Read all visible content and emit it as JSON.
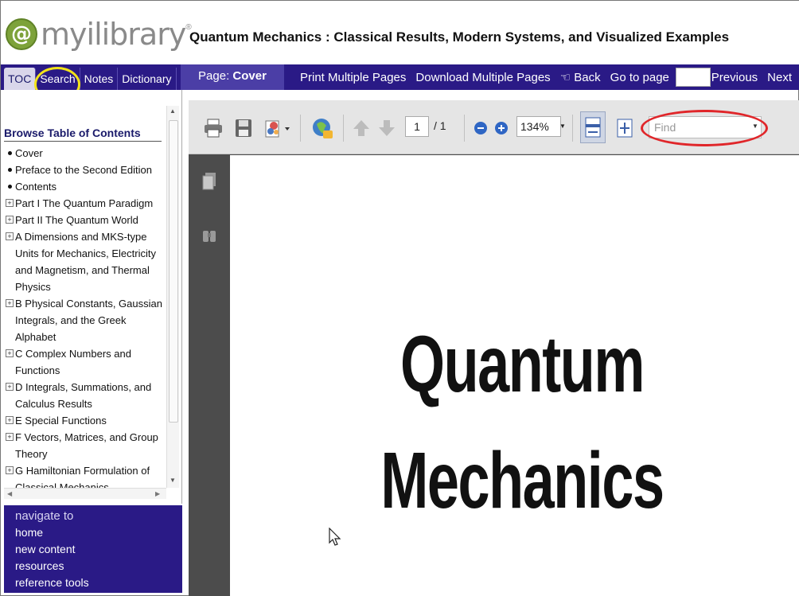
{
  "header": {
    "logo_text": "myilibrary",
    "logo_badge": "@",
    "logo_reg": "®",
    "book_title": "Quantum Mechanics : Classical Results, Modern Systems, and Visualized Examples"
  },
  "navbar": {
    "tabs": [
      {
        "label": "TOC"
      },
      {
        "label": "Search"
      },
      {
        "label": "Notes"
      },
      {
        "label": "Dictionary"
      }
    ],
    "page_label_prefix": "Page:",
    "page_label_value": "Cover",
    "links": {
      "print": "Print Multiple Pages",
      "download": "Download Multiple Pages",
      "back": "Back",
      "goto": "Go to page",
      "previous": "Previous",
      "next": "Next"
    },
    "goto_value": ""
  },
  "toc": {
    "heading": "Browse Table of Contents",
    "items": [
      {
        "type": "bullet",
        "label": "Cover"
      },
      {
        "type": "bullet",
        "label": "Preface to the Second Edition"
      },
      {
        "type": "bullet",
        "label": "Contents"
      },
      {
        "type": "expand",
        "label": "Part I The Quantum Paradigm"
      },
      {
        "type": "expand",
        "label": "Part II The Quantum World"
      },
      {
        "type": "expand",
        "label": "A Dimensions and MKS-type Units for Mechanics, Electricity and Magnetism, and Thermal Physics"
      },
      {
        "type": "expand",
        "label": "B Physical Constants, Gaussian Integrals, and the Greek Alphabet"
      },
      {
        "type": "expand",
        "label": "C Complex Numbers and Functions"
      },
      {
        "type": "expand",
        "label": "D Integrals, Summations, and Calculus Results"
      },
      {
        "type": "expand",
        "label": "E Special Functions"
      },
      {
        "type": "expand",
        "label": "F Vectors, Matrices, and Group Theory"
      },
      {
        "type": "expand",
        "label": "G Hamiltonian Formulation of Classical Mechanics"
      }
    ]
  },
  "nav_panel": {
    "title": "navigate to",
    "links": [
      "home",
      "new content",
      "resources",
      "reference tools"
    ]
  },
  "viewer": {
    "page_input": "1",
    "page_total": "/ 1",
    "zoom": "134%",
    "find_placeholder": "Find",
    "page_text": [
      "Quantum",
      "Mechanics"
    ]
  },
  "colors": {
    "nav_bg": "#2a1a86",
    "highlight_yellow": "#f2e21a",
    "highlight_red": "#e0262a",
    "logo_green": "#7da23a"
  }
}
